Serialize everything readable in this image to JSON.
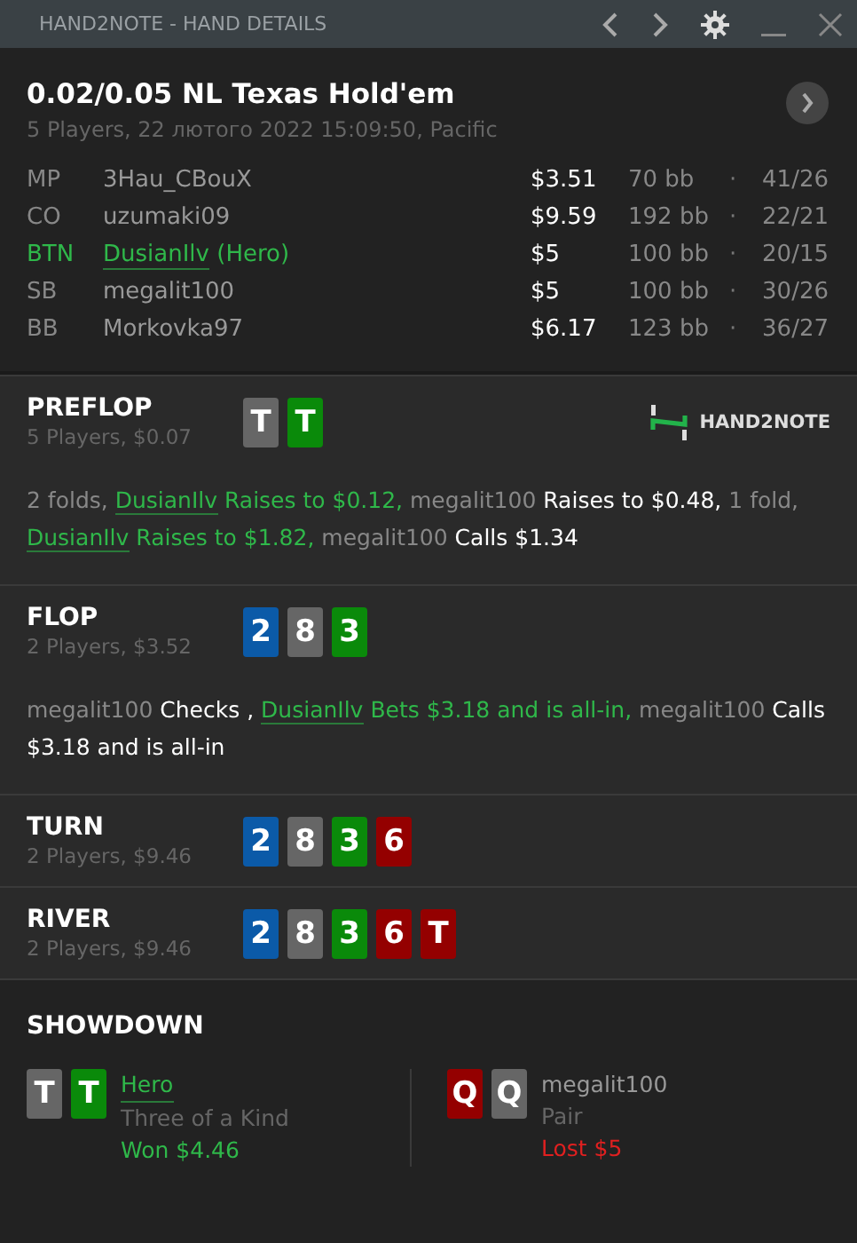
{
  "window": {
    "title": "HAND2NOTE - HAND DETAILS"
  },
  "hand": {
    "title": "0.02/0.05 NL Texas Hold'em",
    "subtitle": "5 Players, 22 лютого 2022 15:09:50, Pacific"
  },
  "players": [
    {
      "position": "MP",
      "name": "3Hau_CBouX",
      "hero": false,
      "stack": "$3.51",
      "bb": "70 bb",
      "separator": "·",
      "stats": "41/26"
    },
    {
      "position": "CO",
      "name": "uzumaki09",
      "hero": false,
      "stack": "$9.59",
      "bb": "192 bb",
      "separator": "·",
      "stats": "22/21"
    },
    {
      "position": "BTN",
      "name": "DusianIlv",
      "hero": true,
      "hero_tag": "(Hero)",
      "stack": "$5",
      "bb": "100 bb",
      "separator": "·",
      "stats": "20/15"
    },
    {
      "position": "SB",
      "name": "megalit100",
      "hero": false,
      "stack": "$5",
      "bb": "100 bb",
      "separator": "·",
      "stats": "30/26"
    },
    {
      "position": "BB",
      "name": "Morkovka97",
      "hero": false,
      "stack": "$6.17",
      "bb": "123 bb",
      "separator": "·",
      "stats": "36/27"
    }
  ],
  "streets": [
    {
      "name": "PREFLOP",
      "info": "5 Players, $0.07",
      "logo": "HAND2NOTE",
      "cards": [
        {
          "rank": "T",
          "color": "#666666"
        },
        {
          "rank": "T",
          "color": "#0a8a0a"
        }
      ],
      "actions": [
        {
          "kind": "plain",
          "text": "2 folds, "
        },
        {
          "kind": "hero_name",
          "text": "DusianIlv"
        },
        {
          "kind": "hero_action",
          "text": " Raises to $0.12, "
        },
        {
          "kind": "player",
          "text": "megalit100"
        },
        {
          "kind": "action",
          "text": " Raises to $0.48, "
        },
        {
          "kind": "plain",
          "text": "1 fold, "
        },
        {
          "kind": "hero_name",
          "text": "DusianIlv"
        },
        {
          "kind": "hero_action",
          "text": " Raises to $1.82, "
        },
        {
          "kind": "player",
          "text": "megalit100"
        },
        {
          "kind": "action",
          "text": " Calls $1.34"
        }
      ]
    },
    {
      "name": "FLOP",
      "info": "2 Players, $3.52",
      "cards": [
        {
          "rank": "2",
          "color": "#0b5aa8"
        },
        {
          "rank": "8",
          "color": "#666666"
        },
        {
          "rank": "3",
          "color": "#0a8a0a"
        }
      ],
      "actions": [
        {
          "kind": "player",
          "text": "megalit100"
        },
        {
          "kind": "action",
          "text": " Checks , "
        },
        {
          "kind": "hero_name",
          "text": "DusianIlv"
        },
        {
          "kind": "hero_action",
          "text": " Bets $3.18 and is all-in, "
        },
        {
          "kind": "player",
          "text": "megalit100"
        },
        {
          "kind": "action",
          "text": " Calls $3.18 and is all-in"
        }
      ]
    },
    {
      "name": "TURN",
      "info": "2 Players, $9.46",
      "cards": [
        {
          "rank": "2",
          "color": "#0b5aa8"
        },
        {
          "rank": "8",
          "color": "#666666"
        },
        {
          "rank": "3",
          "color": "#0a8a0a"
        },
        {
          "rank": "6",
          "color": "#940000"
        }
      ]
    },
    {
      "name": "RIVER",
      "info": "2 Players, $9.46",
      "cards": [
        {
          "rank": "2",
          "color": "#0b5aa8"
        },
        {
          "rank": "8",
          "color": "#666666"
        },
        {
          "rank": "3",
          "color": "#0a8a0a"
        },
        {
          "rank": "6",
          "color": "#940000"
        },
        {
          "rank": "T",
          "color": "#940000"
        }
      ]
    }
  ],
  "showdown": {
    "title": "SHOWDOWN",
    "hands": [
      {
        "name": "Hero",
        "hero": true,
        "hand": "Three of a Kind",
        "result": "Won $4.46",
        "won": true,
        "cards": [
          {
            "rank": "T",
            "color": "#666666"
          },
          {
            "rank": "T",
            "color": "#0a8a0a"
          }
        ]
      },
      {
        "name": "megalit100",
        "hero": false,
        "hand": "Pair",
        "result": "Lost $5",
        "won": false,
        "cards": [
          {
            "rank": "Q",
            "color": "#940000"
          },
          {
            "rank": "Q",
            "color": "#666666"
          }
        ]
      }
    ]
  }
}
